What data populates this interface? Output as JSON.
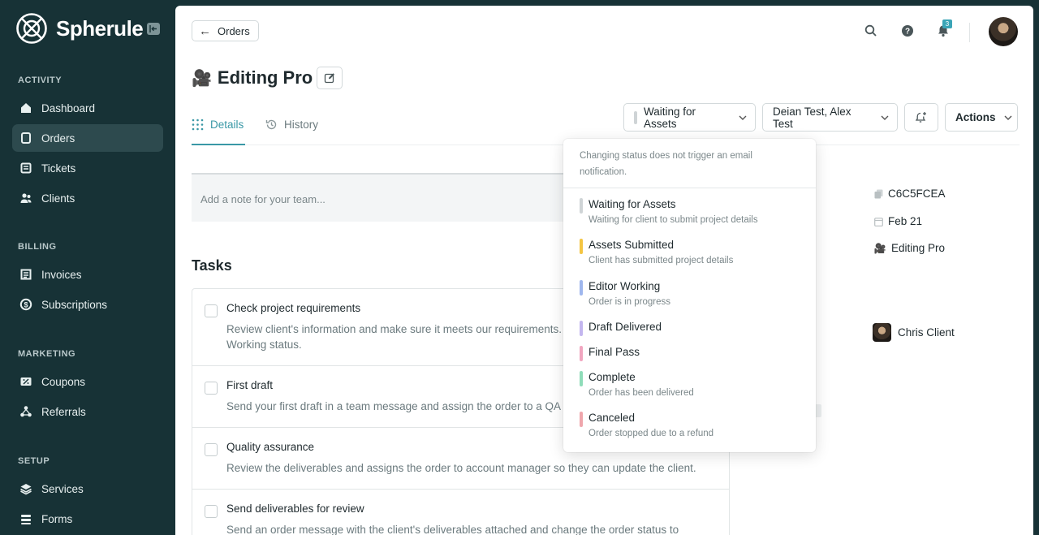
{
  "brand": {
    "name": "Spherule"
  },
  "sidebar": {
    "sections": [
      {
        "title": "ACTIVITY",
        "items": [
          {
            "label": "Dashboard",
            "icon": "home-icon"
          },
          {
            "label": "Orders",
            "icon": "orders-icon",
            "active": true
          },
          {
            "label": "Tickets",
            "icon": "tickets-icon"
          },
          {
            "label": "Clients",
            "icon": "clients-icon"
          }
        ]
      },
      {
        "title": "BILLING",
        "items": [
          {
            "label": "Invoices",
            "icon": "invoice-icon"
          },
          {
            "label": "Subscriptions",
            "icon": "subscription-icon"
          }
        ]
      },
      {
        "title": "MARKETING",
        "items": [
          {
            "label": "Coupons",
            "icon": "coupon-icon"
          },
          {
            "label": "Referrals",
            "icon": "referrals-icon"
          }
        ]
      },
      {
        "title": "SETUP",
        "items": [
          {
            "label": "Services",
            "icon": "services-icon"
          },
          {
            "label": "Forms",
            "icon": "forms-icon"
          }
        ]
      }
    ]
  },
  "header": {
    "back_label": "Orders",
    "notification_count": "3",
    "accent_color": "#3a98a6"
  },
  "order": {
    "emoji": "🎥",
    "title": "Editing Pro",
    "status": "Waiting for Assets",
    "assignees": "Deian Test, Alex Test",
    "actions_label": "Actions",
    "id": "C6C5FCEA",
    "date": "Feb 21",
    "service": "Editing Pro",
    "client": "Chris Client"
  },
  "tabs": [
    {
      "label": "Details",
      "icon": "grid-icon"
    },
    {
      "label": "History",
      "icon": "history-icon"
    }
  ],
  "note": {
    "placeholder": "Add a note for your team..."
  },
  "tasks": {
    "title": "Tasks",
    "items": [
      {
        "title": "Check project requirements",
        "desc": "Review client's information and make sure it meets our requirements. T",
        "desc2": "Working status."
      },
      {
        "title": "First draft",
        "desc": "Send your first draft in a team message and assign the order to a QA m"
      },
      {
        "title": "Quality assurance",
        "desc": "Review the deliverables and assigns the order to account manager so they can update the client."
      },
      {
        "title": "Send deliverables for review",
        "desc": "Send an order message with the client's deliverables attached and change the order status to"
      }
    ]
  },
  "status_dropdown": {
    "note": "Changing status does not trigger an email notification.",
    "options": [
      {
        "label": "Waiting for Assets",
        "desc": "Waiting for client to submit project details",
        "color": "#cfd4d6"
      },
      {
        "label": "Assets Submitted",
        "desc": "Client has submitted project details",
        "color": "#f4c542"
      },
      {
        "label": "Editor Working",
        "desc": "Order is in progress",
        "color": "#9fb7ee"
      },
      {
        "label": "Draft Delivered",
        "desc": "",
        "color": "#c3b6ef"
      },
      {
        "label": "Final Pass",
        "desc": "",
        "color": "#f1a6c0"
      },
      {
        "label": "Complete",
        "desc": "Order has been delivered",
        "color": "#8fdcb9"
      },
      {
        "label": "Canceled",
        "desc": "Order stopped due to a refund",
        "color": "#efa6ac"
      }
    ]
  }
}
